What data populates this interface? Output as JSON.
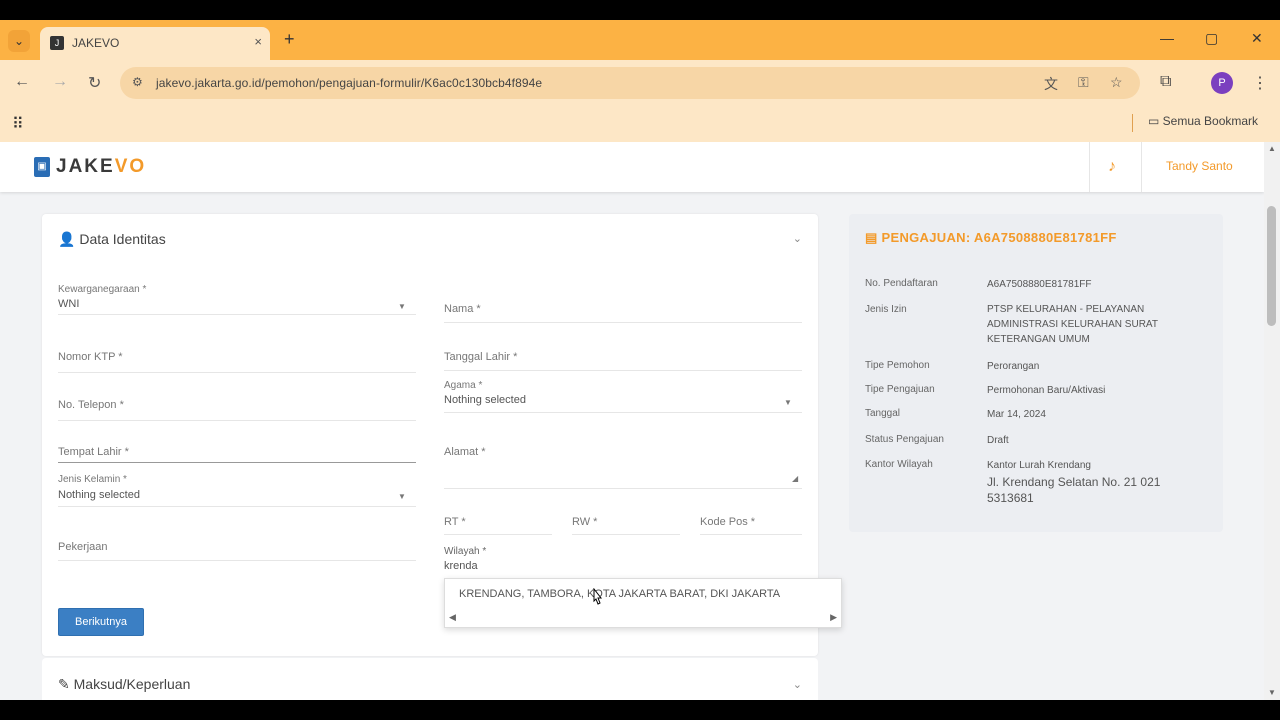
{
  "browser": {
    "tab_title": "JAKEVO",
    "tab_close": "×",
    "new_tab": "+",
    "url": "jakevo.jakarta.go.id/pemohon/pengajuan-formulir/K6ac0c130bcb4f894e",
    "bookmarks_folder": "Semua Bookmark",
    "profile_initial": "P"
  },
  "header": {
    "logo_main": "JAKE",
    "logo_accent": "VO",
    "user_label": "Tandy Santo"
  },
  "form": {
    "section_title": "Data Identitas",
    "fields": {
      "kewarganegaraan_label": "Kewarganegaraan *",
      "kewarganegaraan_value": "WNI",
      "nama_label": "Nama *",
      "nik_label": "Nomor KTP *",
      "tanggal_lahir_label": "Tanggal Lahir *",
      "no_telepon_label": "No. Telepon *",
      "agama_label": "Agama *",
      "agama_value": "Nothing selected",
      "tempat_lahir_label": "Tempat Lahir *",
      "alamat_label": "Alamat *",
      "jenis_kelamin_label": "Jenis Kelamin *",
      "jenis_kelamin_value": "Nothing selected",
      "rt_label": "RT *",
      "rw_label": "RW *",
      "kode_pos_label": "Kode Pos *",
      "pekerjaan_label": "Pekerjaan",
      "wilayah_label": "Wilayah *",
      "wilayah_value": "krenda"
    },
    "next_button": "Berikutnya",
    "suggestion": "KRENDANG, TAMBORA, KOTA JAKARTA BARAT, DKI JAKARTA",
    "section2_title": "Maksud/Keperluan"
  },
  "summary": {
    "title": "PENGAJUAN: A6A7508880E81781FF",
    "rows": [
      {
        "label": "No. Pendaftaran",
        "value": "A6A7508880E81781FF"
      },
      {
        "label": "Jenis Izin",
        "value": "PTSP KELURAHAN - PELAYANAN ADMINISTRASI KELURAHAN SURAT KETERANGAN UMUM"
      },
      {
        "label": "Tipe Pemohon",
        "value": "Perorangan"
      },
      {
        "label": "Tipe Pengajuan",
        "value": "Permohonan Baru/Aktivasi"
      },
      {
        "label": "Tanggal",
        "value": "Mar 14, 2024"
      },
      {
        "label": "Status Pengajuan",
        "value": "Draft"
      },
      {
        "label": "Kantor Wilayah",
        "value": "Kantor Lurah Krendang"
      }
    ],
    "address": "Jl. Krendang Selatan No. 21 021 5313681"
  },
  "icons": {
    "bell": "bell-icon",
    "user": "user-icon",
    "edit": "edit-icon"
  }
}
